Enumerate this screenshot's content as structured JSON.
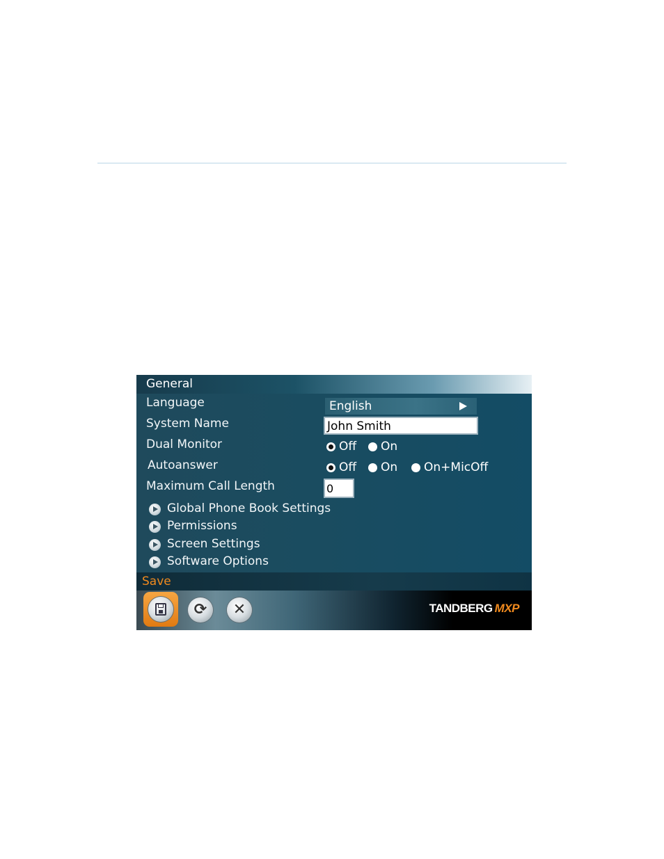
{
  "window": {
    "title": "General"
  },
  "fields": {
    "language": {
      "label": "Language",
      "value": "English"
    },
    "system_name": {
      "label": "System Name",
      "value": "John Smith"
    },
    "dual_monitor": {
      "label": "Dual Monitor",
      "options": [
        "Off",
        "On"
      ],
      "selected": "Off"
    },
    "autoanswer": {
      "label": "Autoanswer",
      "options": [
        "Off",
        "On",
        "On+MicOff"
      ],
      "selected": "Off"
    },
    "max_call_length": {
      "label": "Maximum Call Length",
      "value": "0"
    }
  },
  "submenus": [
    {
      "label": "Global Phone Book Settings"
    },
    {
      "label": "Permissions"
    },
    {
      "label": "Screen Settings"
    },
    {
      "label": "Software Options"
    }
  ],
  "footer": {
    "action_label": "Save",
    "buttons": [
      {
        "icon": "floppy-disk-icon",
        "name": "save"
      },
      {
        "icon": "refresh-icon",
        "name": "refresh"
      },
      {
        "icon": "close-icon",
        "name": "cancel"
      }
    ],
    "brand": {
      "name": "TANDBERG",
      "suffix": "MXP"
    }
  },
  "colors": {
    "accent": "#f08a1e",
    "panel": "#1a4c60",
    "rule": "#b9d7e6"
  }
}
